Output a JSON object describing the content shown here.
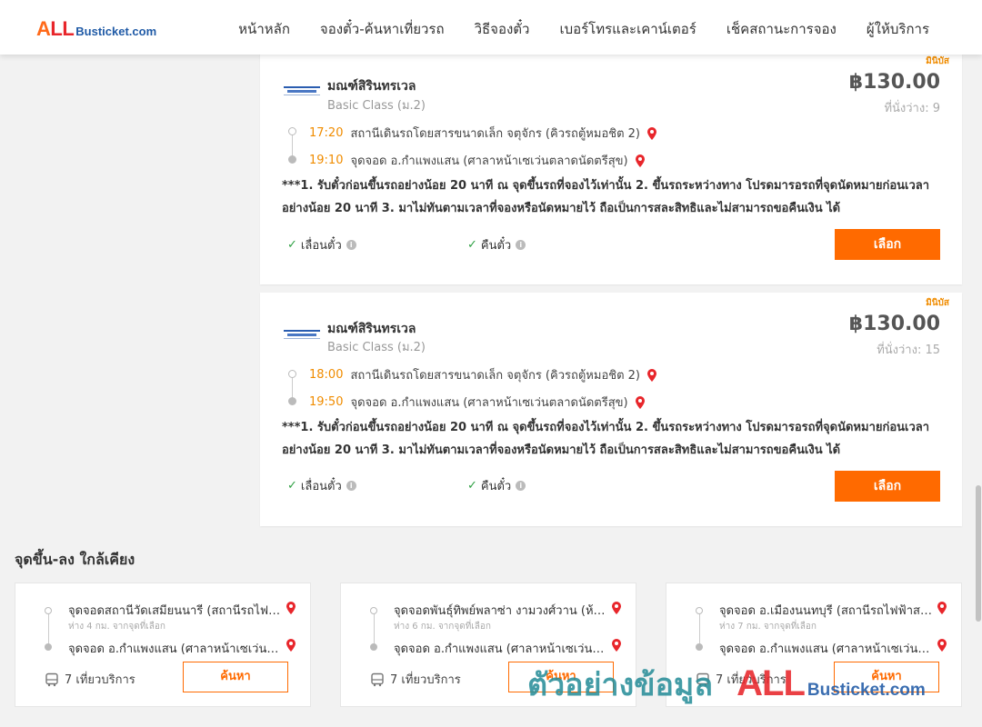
{
  "header": {
    "logo_all": "ALL",
    "logo_rest": "Busticket.com",
    "nav": [
      "หน้าหลัก",
      "จองตั๋ว-ค้นหาเที่ยวรถ",
      "วิธีจองตั๋ว",
      "เบอร์โทรและเคาน์เตอร์",
      "เช็คสถานะการจอง",
      "ผู้ให้บริการ"
    ]
  },
  "trips": [
    {
      "badge": "มินิบัส",
      "operator": "มณฑ์สิรินทรเวล",
      "class": "Basic Class (ม.2)",
      "price": "฿130.00",
      "seats": "ที่นั่งว่าง: 9",
      "depart_time": "17:20",
      "depart_place": "สถานีเดินรถโดยสารขนาดเล็ก จตุจักร (คิวรถตู้หมอชิต 2)",
      "arrive_time": "19:10",
      "arrive_place": "จุดจอด อ.กำแพงแสน (ศาลาหน้าเซเว่นตลาดนัดตรีสุข)",
      "note": "***1. รับตั๋วก่อนขึ้นรถอย่างน้อย 20 นาที ณ จุดขึ้นรถที่จองไว้เท่านั้น 2. ขึ้นรถระหว่างทาง โปรดมารอรถที่จุดนัดหมายก่อนเวลาอย่างน้อย 20 นาที 3. มาไม่ทันตามเวลาที่จองหรือนัดหมายไว้ ถือเป็นการสละสิทธิและไม่สามารถขอคืนเงิน ได้",
      "feature1": "เลื่อนตั๋ว",
      "feature2": "คืนตั๋ว",
      "button": "เลือก"
    },
    {
      "badge": "มินิบัส",
      "operator": "มณฑ์สิรินทรเวล",
      "class": "Basic Class (ม.2)",
      "price": "฿130.00",
      "seats": "ที่นั่งว่าง: 15",
      "depart_time": "18:00",
      "depart_place": "สถานีเดินรถโดยสารขนาดเล็ก จตุจักร (คิวรถตู้หมอชิต 2)",
      "arrive_time": "19:50",
      "arrive_place": "จุดจอด อ.กำแพงแสน (ศาลาหน้าเซเว่นตลาดนัดตรีสุข)",
      "note": "***1. รับตั๋วก่อนขึ้นรถอย่างน้อย 20 นาที ณ จุดขึ้นรถที่จองไว้เท่านั้น 2. ขึ้นรถระหว่างทาง โปรดมารอรถที่จุดนัดหมายก่อนเวลาอย่างน้อย 20 นาที 3. มาไม่ทันตามเวลาที่จองหรือนัดหมายไว้ ถือเป็นการสละสิทธิและไม่สามารถขอคืนเงิน ได้",
      "feature1": "เลื่อนตั๋ว",
      "feature2": "คืนตั๋ว",
      "button": "เลือก"
    }
  ],
  "nearby": {
    "title": "จุดขึ้น-ลง ใกล้เคียง",
    "items": [
      {
        "from": "จุดจอดสถานีวัดเสมียนนารี (สถานีรถไฟฟ้าสายสีแดง)",
        "distance": "ห่าง 4 กม. จากจุดที่เลือก",
        "to": "จุดจอด อ.กำแพงแสน (ศาลาหน้าเซเว่นตลาดนัดตรีสุข)",
        "trips": "7 เที่ยวบริการ",
        "button": "ค้นหา"
      },
      {
        "from": "จุดจอดพันธุ์ทิพย์พลาซ่า งามวงศ์วาน (ห้างสรรพสินค้า)",
        "distance": "ห่าง 6 กม. จากจุดที่เลือก",
        "to": "จุดจอด อ.กำแพงแสน (ศาลาหน้าเซเว่นตลาดนัดตรีสุข)",
        "trips": "7 เที่ยวบริการ",
        "button": "ค้นหา"
      },
      {
        "from": "จุดจอด อ.เมืองนนทบุรี (สถานีรถไฟฟ้าสายสีม่วง)",
        "distance": "ห่าง 7 กม. จากจุดที่เลือก",
        "to": "จุดจอด อ.กำแพงแสน (ศาลาหน้าเซเว่นตลาดนัดตรีสุข)",
        "trips": "7 เที่ยวบริการ",
        "button": "ค้นหา"
      }
    ]
  },
  "watermark": {
    "text": "ตัวอย่างข้อมูล",
    "all": "ALL",
    "rest": "Busticket.com"
  },
  "colors": {
    "accent": "#ff6a00",
    "time": "#f08c00",
    "pin": "#e8262b",
    "check": "#2ea043"
  }
}
